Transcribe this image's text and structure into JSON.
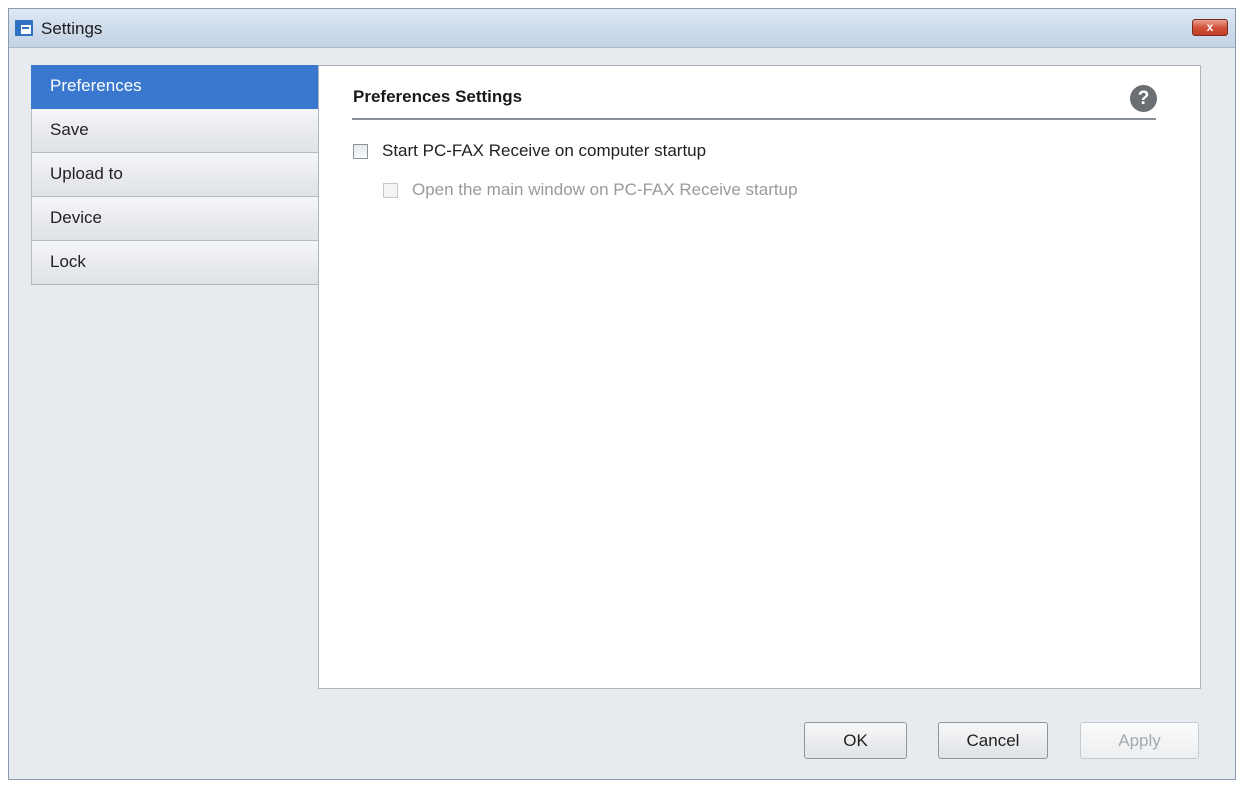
{
  "window": {
    "title": "Settings",
    "icon": "settings-window-icon",
    "close_label": "x"
  },
  "sidebar": {
    "items": [
      {
        "label": "Preferences",
        "selected": true
      },
      {
        "label": "Save",
        "selected": false
      },
      {
        "label": "Upload to",
        "selected": false
      },
      {
        "label": "Device",
        "selected": false
      },
      {
        "label": "Lock",
        "selected": false
      }
    ]
  },
  "main": {
    "section_title": "Preferences Settings",
    "help_icon_glyph": "?",
    "options": [
      {
        "label": "Start PC-FAX Receive on computer startup",
        "checked": false,
        "enabled": true
      },
      {
        "label": "Open the main window on PC-FAX Receive startup",
        "checked": false,
        "enabled": false
      }
    ]
  },
  "footer": {
    "ok_label": "OK",
    "cancel_label": "Cancel",
    "apply_label": "Apply",
    "apply_enabled": false
  },
  "colors": {
    "accent": "#3a78cf",
    "close_button": "#c23c24"
  }
}
